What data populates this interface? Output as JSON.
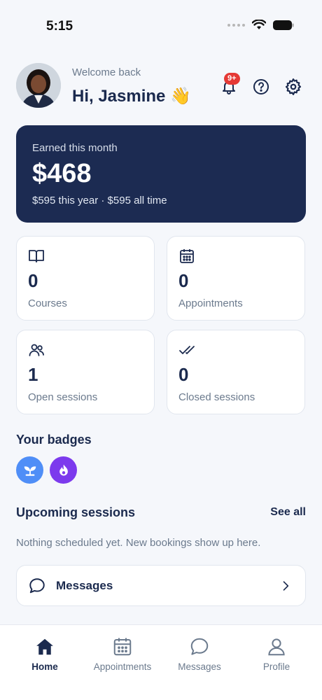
{
  "status_bar": {
    "time": "5:15"
  },
  "header": {
    "welcome": "Welcome back",
    "greeting": "Hi, Jasmine 👋",
    "notification_count": "9+"
  },
  "earnings": {
    "label": "Earned this month",
    "amount": "$468",
    "subtext": "$595 this year · $595 all time"
  },
  "stats": [
    {
      "value": "0",
      "label": "Courses",
      "icon": "book-icon"
    },
    {
      "value": "0",
      "label": "Appointments",
      "icon": "calendar-icon"
    },
    {
      "value": "1",
      "label": "Open sessions",
      "icon": "users-icon"
    },
    {
      "value": "0",
      "label": "Closed sessions",
      "icon": "double-check-icon"
    }
  ],
  "badges": {
    "title": "Your badges",
    "items": [
      {
        "icon": "sprout-icon",
        "color": "#4f8ef7"
      },
      {
        "icon": "flame-icon",
        "color": "#7c3aed"
      }
    ]
  },
  "upcoming": {
    "title": "Upcoming sessions",
    "see_all": "See all",
    "empty": "Nothing scheduled yet. New bookings show up here."
  },
  "messages_row": {
    "label": "Messages"
  },
  "tabs": [
    {
      "label": "Home",
      "icon": "home-icon",
      "active": true
    },
    {
      "label": "Appointments",
      "icon": "calendar-icon",
      "active": false
    },
    {
      "label": "Messages",
      "icon": "chat-icon",
      "active": false
    },
    {
      "label": "Profile",
      "icon": "person-icon",
      "active": false
    }
  ],
  "colors": {
    "primary": "#1c2b52",
    "background": "#f5f7fb",
    "notification": "#e53935"
  }
}
